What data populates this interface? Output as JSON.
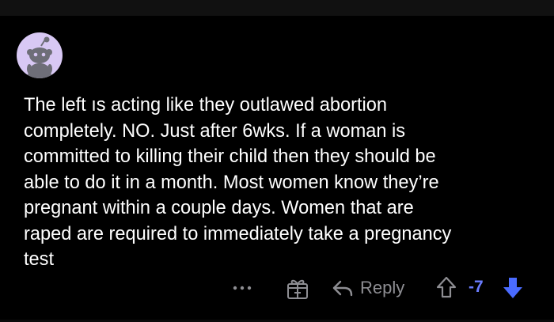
{
  "comment": {
    "author": "",
    "body": "The left ıs acting like they outlawed abortion\ncompletely. NO. Just after 6wks. If a woman is\ncommitted to killing their child then they should be\nable to do it in a month. Most women know they’re\npregnant within a couple days. Women that are\nraped are required to immediately take a pregnancy\ntest",
    "avatar_icon": "snoo-avatar-icon",
    "avatar_color": "#d8c8f4"
  },
  "actions": {
    "more_icon": "more-horizontal-icon",
    "award_icon": "gift-award-icon",
    "reply_icon": "reply-arrow-icon",
    "reply_label": "Reply",
    "upvote_icon": "upvote-arrow-icon",
    "score": "-7",
    "downvote_icon": "downvote-arrow-icon",
    "score_color": "#6a7cff",
    "downvote_color": "#4a6bff",
    "muted_color": "#8e8e93"
  }
}
